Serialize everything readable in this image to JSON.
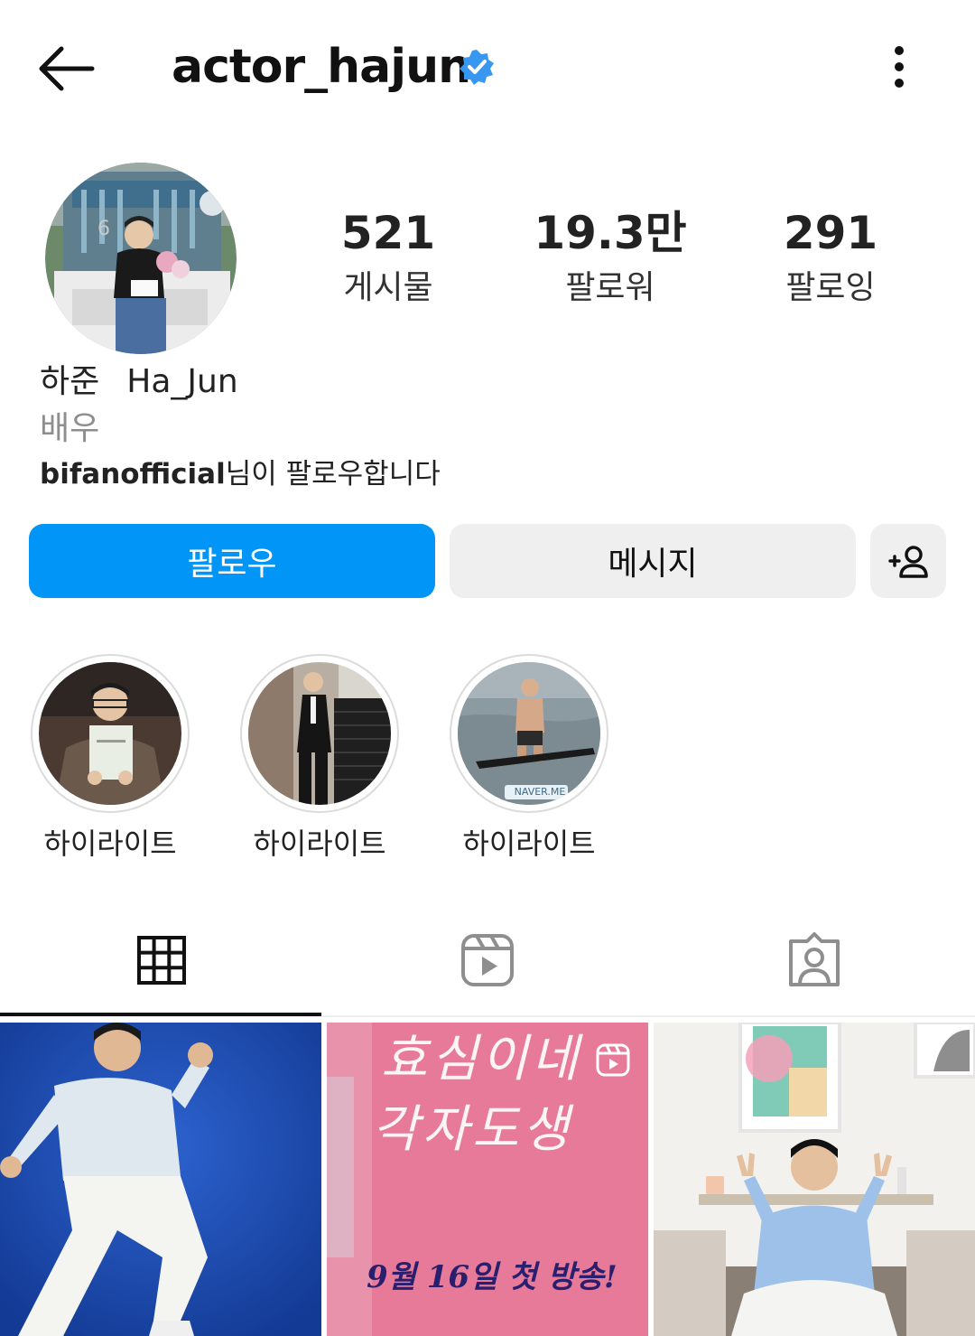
{
  "header": {
    "username": "actor_hajun",
    "verified_icon": "verified-badge-icon",
    "back_icon": "back-arrow-icon",
    "more_icon": "more-vertical-icon",
    "verified_color": "#3897f0"
  },
  "profile": {
    "name_korean": "하준",
    "name_latin": "Ha_Jun",
    "category": "배우",
    "followed_by_user": "bifanofficial",
    "followed_by_suffix": "님이 팔로우합니다"
  },
  "stats": [
    {
      "value": "521",
      "label": "게시물"
    },
    {
      "value": "19.3만",
      "label": "팔로워"
    },
    {
      "value": "291",
      "label": "팔로잉"
    }
  ],
  "actions": {
    "follow_label": "팔로우",
    "message_label": "메시지",
    "add_user_icon": "add-person-icon",
    "follow_color": "#0095f6"
  },
  "highlights": [
    {
      "label": "하이라이트"
    },
    {
      "label": "하이라이트"
    },
    {
      "label": "하이라이트",
      "badge": "NAVER.ME"
    }
  ],
  "tabs": [
    {
      "icon": "grid-icon",
      "active": true
    },
    {
      "icon": "reels-icon",
      "active": false
    },
    {
      "icon": "tagged-icon",
      "active": false
    }
  ],
  "posts": [
    {
      "kind": "photo"
    },
    {
      "kind": "reel",
      "text_line1": "효심이네",
      "text_line2": "각자도생",
      "text_line3": "9월 16일 첫 방송!"
    },
    {
      "kind": "photo"
    }
  ]
}
